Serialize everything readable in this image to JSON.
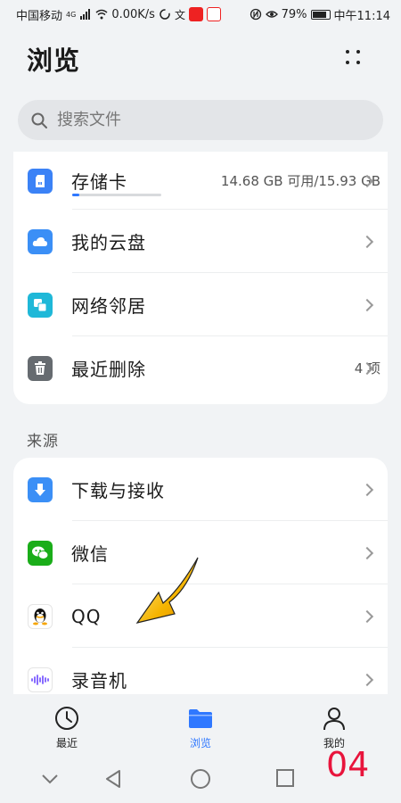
{
  "status_bar": {
    "carrier": "中国移动",
    "net_type": "4G",
    "speed": "0.00K/s",
    "battery": "79%",
    "time": "中午11:14"
  },
  "header": {
    "title": "浏览"
  },
  "search": {
    "placeholder": "搜索文件"
  },
  "storage": {
    "items": [
      {
        "label": "存储卡",
        "meta": "14.68 GB 可用/15.93 GB",
        "icon": "sd-card-icon",
        "color": "#3b82f6",
        "usage_fraction": 0.078
      },
      {
        "label": "我的云盘",
        "meta": "",
        "icon": "cloud-icon",
        "color": "#3b8ff6"
      },
      {
        "label": "网络邻居",
        "meta": "",
        "icon": "network-neighbor-icon",
        "color": "#1fb8d8"
      },
      {
        "label": "最近删除",
        "meta": "4 项",
        "icon": "trash-icon",
        "color": "#666b70"
      }
    ]
  },
  "sources": {
    "title": "来源",
    "items": [
      {
        "label": "下载与接收",
        "icon": "download-icon",
        "color": "#3b8ff6"
      },
      {
        "label": "微信",
        "icon": "wechat-icon",
        "color": "#1aad19"
      },
      {
        "label": "QQ",
        "icon": "qq-icon",
        "color": "#111111"
      },
      {
        "label": "录音机",
        "icon": "recorder-icon",
        "color": "#7a5cff"
      }
    ]
  },
  "bottom_nav": {
    "tabs": [
      {
        "label": "最近",
        "icon": "clock-icon"
      },
      {
        "label": "浏览",
        "icon": "folder-icon",
        "active": true
      },
      {
        "label": "我的",
        "icon": "person-icon"
      }
    ],
    "accent": "#2f78ff"
  },
  "overlay": {
    "number": "04",
    "color": "#e8143c"
  }
}
